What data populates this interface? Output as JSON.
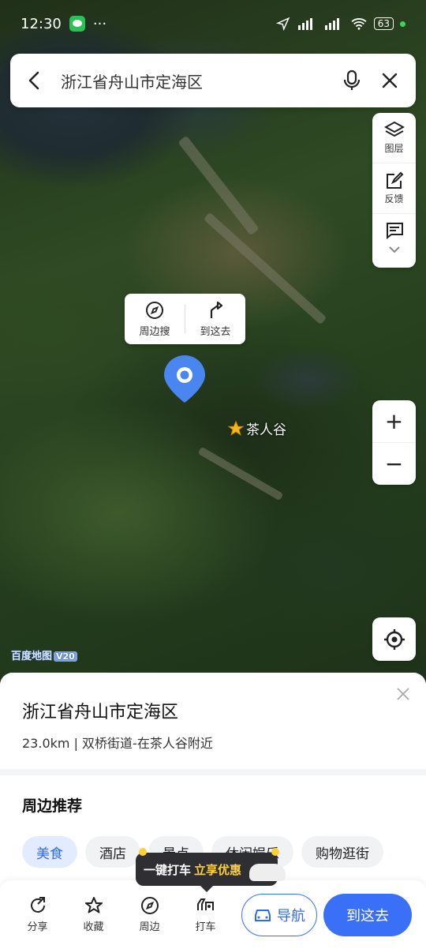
{
  "status_bar": {
    "time": "12:30",
    "dots": "···",
    "battery": "63"
  },
  "search": {
    "query": "浙江省舟山市定海区"
  },
  "tools": [
    {
      "label": "图层",
      "icon": "layers-icon"
    },
    {
      "label": "反馈",
      "icon": "feedback-icon"
    },
    {
      "label": "",
      "icon": "message-icon"
    }
  ],
  "popup": {
    "nearby_search": "周边搜",
    "go_here": "到这去"
  },
  "map": {
    "poi_label": "茶人谷",
    "logo": "百度地图",
    "logo_version": "V20"
  },
  "zoom": {
    "in": "+",
    "out": "−"
  },
  "place": {
    "title": "浙江省舟山市定海区",
    "subtitle": "23.0km | 双桥街道-在茶人谷附近"
  },
  "nearby": {
    "title": "周边推荐",
    "chips": [
      "美食",
      "酒店",
      "景点",
      "休闲娱乐",
      "购物逛街"
    ]
  },
  "promo": {
    "text": "一键打车",
    "highlight": "立享优惠"
  },
  "bottom_nav": {
    "share": "分享",
    "favorite": "收藏",
    "nearby": "周边",
    "taxi": "打车",
    "navigate": "导航",
    "go_here": "到这去"
  },
  "colors": {
    "accent": "#3a6ff7",
    "pin": "#4a86f0"
  }
}
